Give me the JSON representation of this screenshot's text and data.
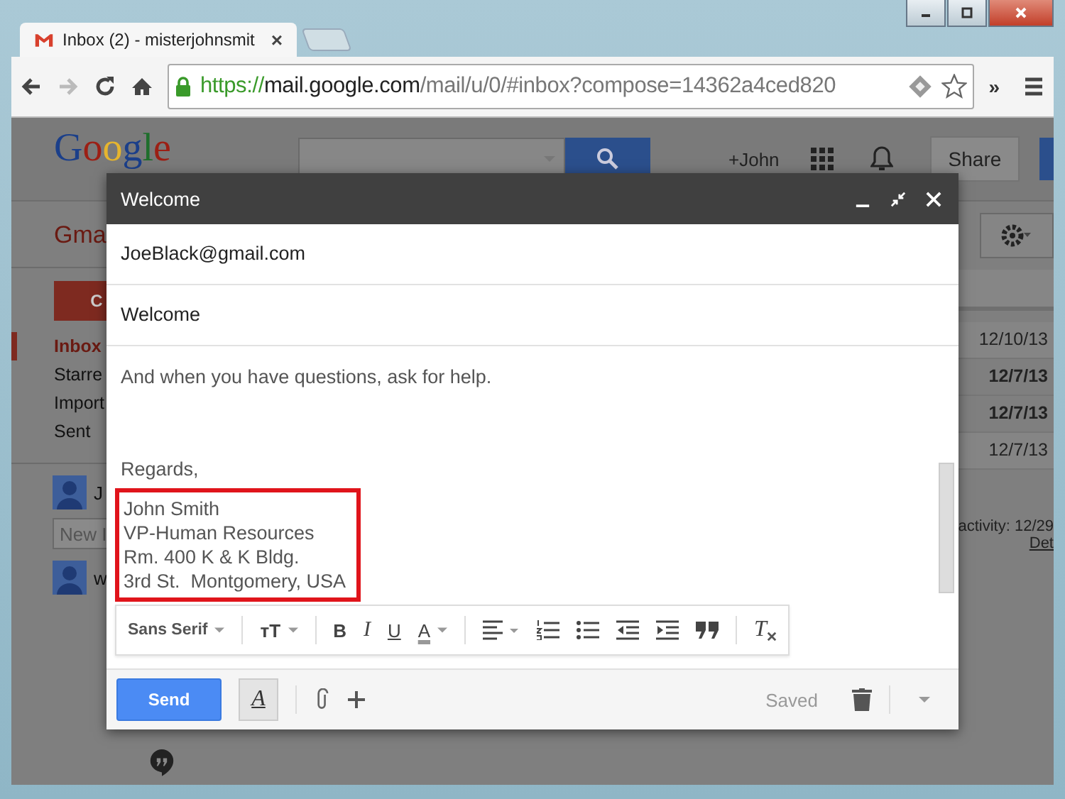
{
  "browser": {
    "tab_title": "Inbox (2) - misterjohnsmit",
    "tab_close": "×",
    "url": {
      "scheme": "https://",
      "host": "mail.google.com",
      "path": "/mail/u/0/#inbox?compose=14362a4ced820"
    },
    "overflow": "»"
  },
  "header": {
    "logo": "Google",
    "account": "+John",
    "share": "Share"
  },
  "sidebar": {
    "app_label": "Gma",
    "compose": "C",
    "items": [
      {
        "label": "Inbox",
        "selected": true
      },
      {
        "label": "Starre",
        "selected": false
      },
      {
        "label": "Import",
        "selected": false
      },
      {
        "label": "Sent",
        "selected": false
      }
    ],
    "contacts": [
      {
        "name": "J"
      },
      {
        "name": "w"
      }
    ],
    "chat_search": {
      "placeholder": "New I"
    }
  },
  "inbox": {
    "dates": [
      {
        "text": "12/10/13",
        "unread": false
      },
      {
        "text": "12/7/13",
        "unread": true
      },
      {
        "text": "12/7/13",
        "unread": true
      },
      {
        "text": "12/7/13",
        "unread": false
      }
    ],
    "activity": "activity: 12/29",
    "details_link": "Det"
  },
  "compose": {
    "title": "Welcome",
    "to": "JoeBlack@gmail.com",
    "subject": "Welcome",
    "body": [
      "And when you have questions, ask for help.",
      "Regards,"
    ],
    "signature": [
      "John Smith",
      "VP-Human Resources",
      "Rm. 400 K & K Bldg.",
      "3rd St.  Montgomery, USA"
    ],
    "signature_highlighted": true,
    "toolbar": {
      "font": "Sans Serif",
      "size": "ᴛT",
      "bold": "B",
      "italic": "I",
      "underline": "U",
      "ink": "A",
      "clear": "T"
    },
    "send": "Send",
    "format": "A",
    "status": "Saved"
  }
}
